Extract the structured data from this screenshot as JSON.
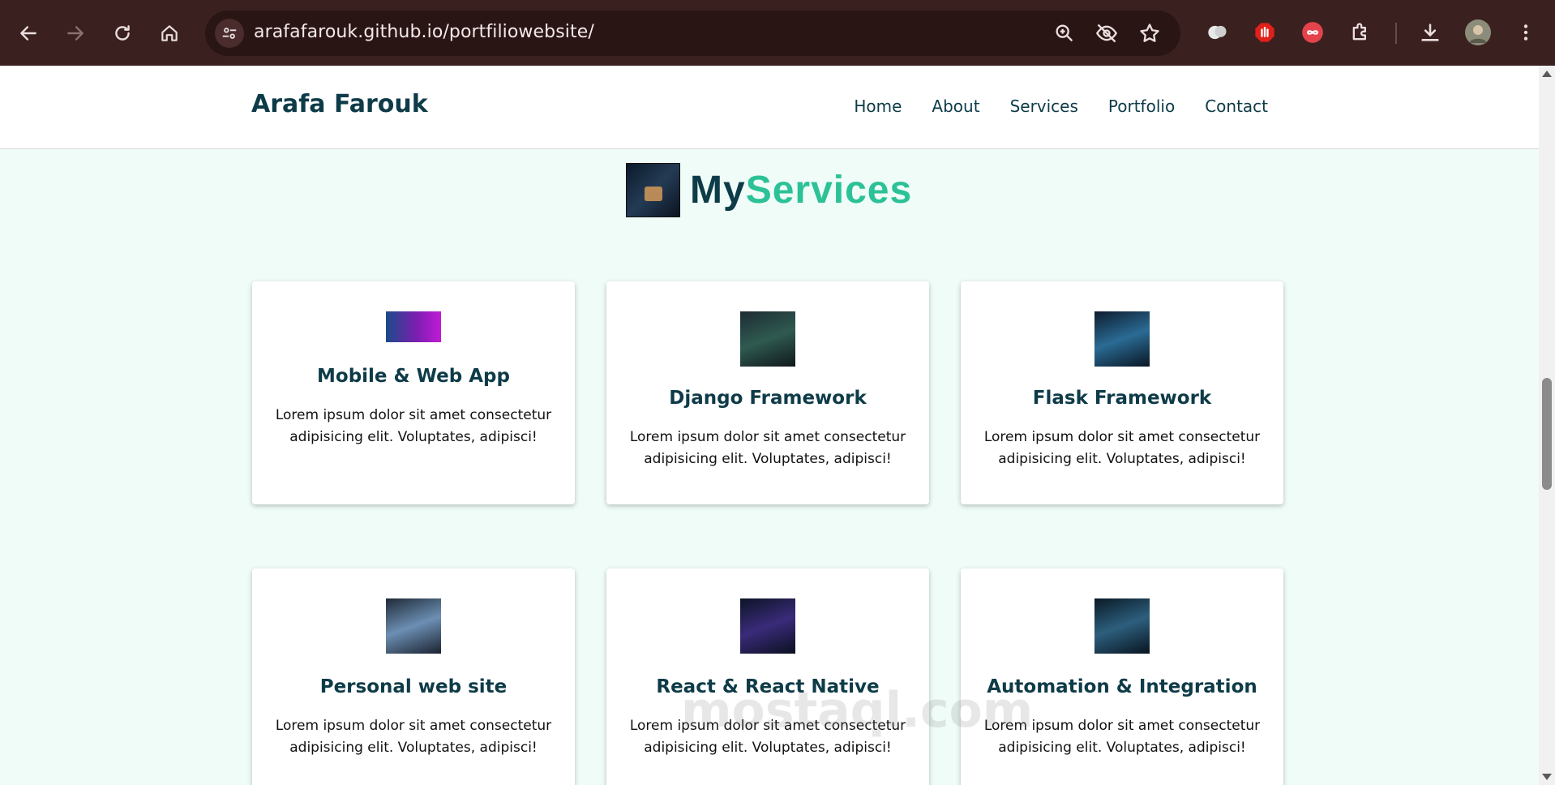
{
  "browser": {
    "url": "arafafarouk.github.io/portfiliowebsite/"
  },
  "site": {
    "brand": "Arafa Farouk",
    "nav": [
      "Home",
      "About",
      "Services",
      "Portfolio",
      "Contact"
    ]
  },
  "section": {
    "title_part1": "My",
    "title_part2": "Services"
  },
  "services": [
    {
      "title": "Mobile & Web App",
      "desc": "Lorem ipsum dolor sit amet consectetur adipisicing elit. Voluptates, adipisci!",
      "icon": "mobile-web-thumbnail"
    },
    {
      "title": "Django Framework",
      "desc": "Lorem ipsum dolor sit amet consectetur adipisicing elit. Voluptates, adipisci!",
      "icon": "django-thumbnail"
    },
    {
      "title": "Flask Framework",
      "desc": "Lorem ipsum dolor sit amet consectetur adipisicing elit. Voluptates, adipisci!",
      "icon": "flask-thumbnail"
    },
    {
      "title": "Personal web site",
      "desc": "Lorem ipsum dolor sit amet consectetur adipisicing elit. Voluptates, adipisci!",
      "icon": "personal-site-thumbnail"
    },
    {
      "title": "React & React Native",
      "desc": "Lorem ipsum dolor sit amet consectetur adipisicing elit. Voluptates, adipisci!",
      "icon": "react-thumbnail"
    },
    {
      "title": "Automation & Integration",
      "desc": "Lorem ipsum dolor sit amet consectetur adipisicing elit. Voluptates, adipisci!",
      "icon": "automation-thumbnail"
    }
  ],
  "watermark": "mostaql.com",
  "colors": {
    "chrome_bg": "#3b2020",
    "brand_dark": "#0e3b48",
    "accent": "#2cc197",
    "page_bg": "#effcf7"
  }
}
